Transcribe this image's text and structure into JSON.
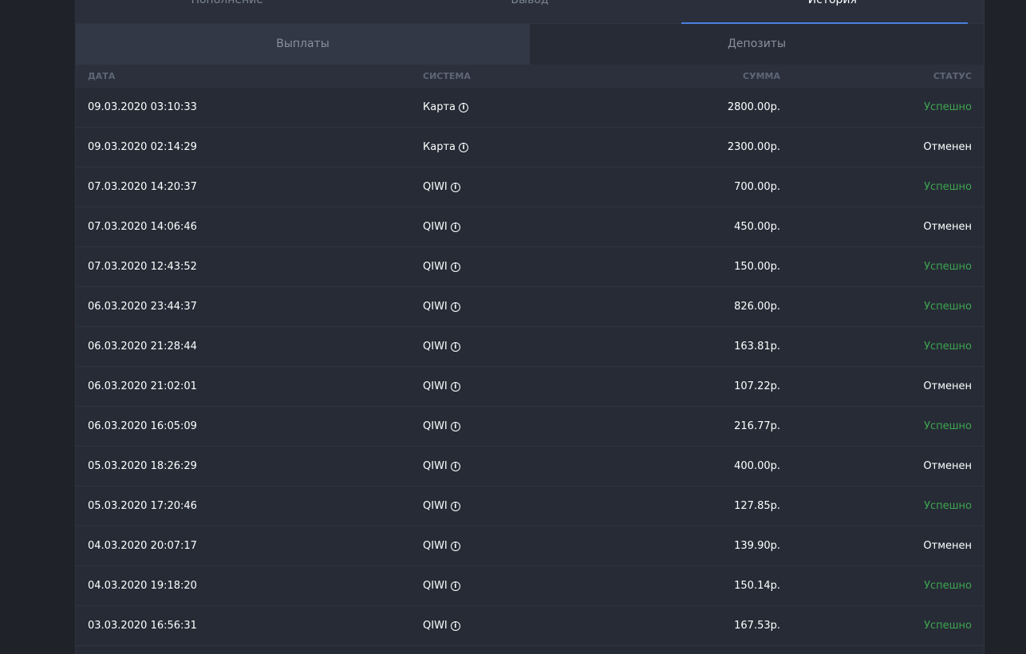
{
  "tabs": [
    "Пополнение",
    "Вывод",
    "История"
  ],
  "subtabs": [
    "Выплаты",
    "Депозиты"
  ],
  "columns": [
    "ДАТА",
    "СИСТЕМА",
    "СУММА",
    "СТАТУС"
  ],
  "colors": {
    "success": "#3fa54f",
    "accent": "#4a7fe0"
  },
  "rows": [
    [
      "09.03.2020 03:10:33",
      "Карта",
      "2800.00р.",
      "Успешно"
    ],
    [
      "09.03.2020 02:14:29",
      "Карта",
      "2300.00р.",
      "Отменен"
    ],
    [
      "07.03.2020 14:20:37",
      "QIWI",
      "700.00р.",
      "Успешно"
    ],
    [
      "07.03.2020 14:06:46",
      "QIWI",
      "450.00р.",
      "Отменен"
    ],
    [
      "07.03.2020 12:43:52",
      "QIWI",
      "150.00р.",
      "Успешно"
    ],
    [
      "06.03.2020 23:44:37",
      "QIWI",
      "826.00р.",
      "Успешно"
    ],
    [
      "06.03.2020 21:28:44",
      "QIWI",
      "163.81р.",
      "Успешно"
    ],
    [
      "06.03.2020 21:02:01",
      "QIWI",
      "107.22р.",
      "Отменен"
    ],
    [
      "06.03.2020 16:05:09",
      "QIWI",
      "216.77р.",
      "Успешно"
    ],
    [
      "05.03.2020 18:26:29",
      "QIWI",
      "400.00р.",
      "Отменен"
    ],
    [
      "05.03.2020 17:20:46",
      "QIWI",
      "127.85р.",
      "Успешно"
    ],
    [
      "04.03.2020 20:07:17",
      "QIWI",
      "139.90р.",
      "Отменен"
    ],
    [
      "04.03.2020 19:18:20",
      "QIWI",
      "150.14р.",
      "Успешно"
    ],
    [
      "03.03.2020 16:56:31",
      "QIWI",
      "167.53р.",
      "Успешно"
    ]
  ]
}
